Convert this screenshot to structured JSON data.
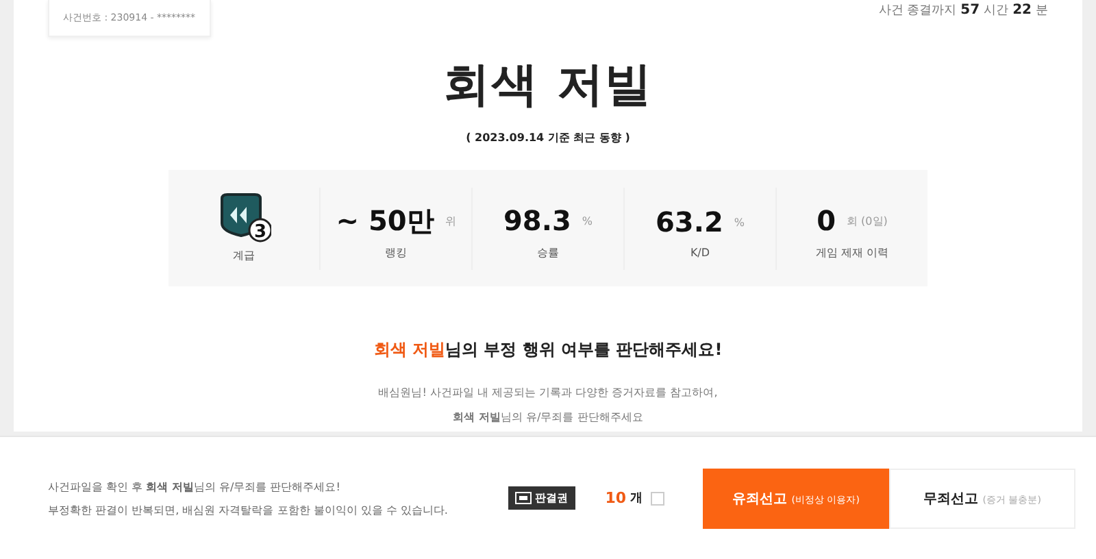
{
  "case_number": "사건번호 : 230914 - ********",
  "countdown": {
    "prefix": "사건 종결까지",
    "hours": "57",
    "hours_unit": "시간",
    "minutes": "22",
    "minutes_unit": "분"
  },
  "title": "회색 저빌",
  "subtitle": "( 2023.09.14 기준 최근 동향 )",
  "stats": [
    {
      "kind": "tier",
      "tier": "3",
      "label": "계급"
    },
    {
      "kind": "value",
      "value": "~ 50만",
      "unit": "위",
      "label": "랭킹"
    },
    {
      "kind": "value",
      "value": "98.3",
      "unit": "%",
      "label": "승률"
    },
    {
      "kind": "value",
      "value": "63.2",
      "unit": "%",
      "label": "K/D"
    },
    {
      "kind": "value",
      "value": "0",
      "unit": "회 (0일)",
      "label": "게임 제재 이력"
    }
  ],
  "prompt": {
    "name": "회색 저빌",
    "rest": "님의 부정 행위 여부를 판단해주세요!"
  },
  "guide": [
    "배심원님! 사건파일 내 제공되는 기록과 다양한 증거자료를 참고하여,",
    "**회색 저빌**님의 유/무죄를 판단해주세요"
  ],
  "footer": {
    "notes": [
      "사건파일을 확인 후 **회색 저빌**님의 유/무죄를 판단해주세요!",
      "부정확한 판결이 반복되면, 배심원 자격탈락을 포함한 불이익이 있을 수 있습니다."
    ],
    "ticket_label": "판결권",
    "ticket_count": "10",
    "ticket_unit": "개",
    "buttons": [
      {
        "kind": "primary",
        "label": "유죄선고",
        "note": "(비정상 이용자)"
      },
      {
        "kind": "secondary",
        "label": "무죄선고",
        "note": "(증거 불충분)"
      }
    ]
  }
}
